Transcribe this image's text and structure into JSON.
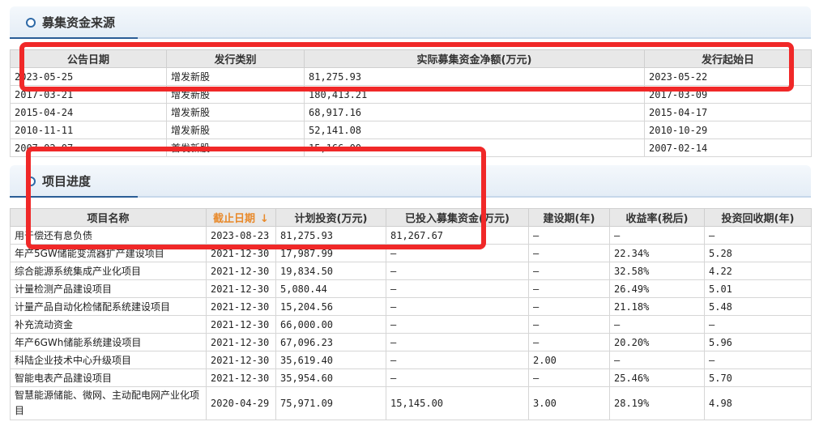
{
  "funding": {
    "title": "募集资金来源",
    "headers": [
      "公告日期",
      "发行类别",
      "实际募集资金净额(万元)",
      "发行起始日"
    ],
    "rows": [
      [
        "2023-05-25",
        "增发新股",
        "81,275.93",
        "2023-05-22"
      ],
      [
        "2017-03-21",
        "增发新股",
        "180,413.21",
        "2017-03-09"
      ],
      [
        "2015-04-24",
        "增发新股",
        "68,917.16",
        "2015-04-17"
      ],
      [
        "2010-11-11",
        "增发新股",
        "52,141.08",
        "2010-10-29"
      ],
      [
        "2007-02-07",
        "首发新股",
        "15,166.00",
        "2007-02-14"
      ]
    ]
  },
  "projects": {
    "title": "项目进度",
    "headers": [
      "项目名称",
      "截止日期",
      "计划投资(万元)",
      "已投入募集资金(万元)",
      "建设期(年)",
      "收益率(税后)",
      "投资回收期(年)"
    ],
    "sort_arrow": "↓",
    "rows": [
      [
        "用于偿还有息负债",
        "2023-08-23",
        "81,275.93",
        "81,267.67",
        "—",
        "—",
        "—"
      ],
      [
        "年产5GW储能变流器扩产建设项目",
        "2021-12-30",
        "17,987.99",
        "—",
        "—",
        "22.34%",
        "5.28"
      ],
      [
        "综合能源系统集成产业化项目",
        "2021-12-30",
        "19,834.50",
        "—",
        "—",
        "32.58%",
        "4.22"
      ],
      [
        "计量检测产品建设项目",
        "2021-12-30",
        "5,080.44",
        "—",
        "—",
        "26.49%",
        "5.01"
      ],
      [
        "计量产品自动化检储配系统建设项目",
        "2021-12-30",
        "15,204.56",
        "—",
        "—",
        "21.18%",
        "5.48"
      ],
      [
        "补充流动资金",
        "2021-12-30",
        "66,000.00",
        "—",
        "—",
        "—",
        "—"
      ],
      [
        "年产6GWh储能系统建设项目",
        "2021-12-30",
        "67,096.23",
        "—",
        "—",
        "20.20%",
        "5.96"
      ],
      [
        "科陆企业技术中心升级项目",
        "2021-12-30",
        "35,619.40",
        "—",
        "2.00",
        "—",
        "—"
      ],
      [
        "智能电表产品建设项目",
        "2021-12-30",
        "35,954.60",
        "—",
        "—",
        "25.46%",
        "5.70"
      ],
      [
        "智慧能源储能、微网、主动配电网产业化项目",
        "2020-04-29",
        "75,971.09",
        "15,145.00",
        "3.00",
        "28.19%",
        "4.98"
      ]
    ]
  },
  "colors": {
    "highlight": "#f02828",
    "sort_header": "#e8892a",
    "section_accent": "#2a5d96"
  }
}
